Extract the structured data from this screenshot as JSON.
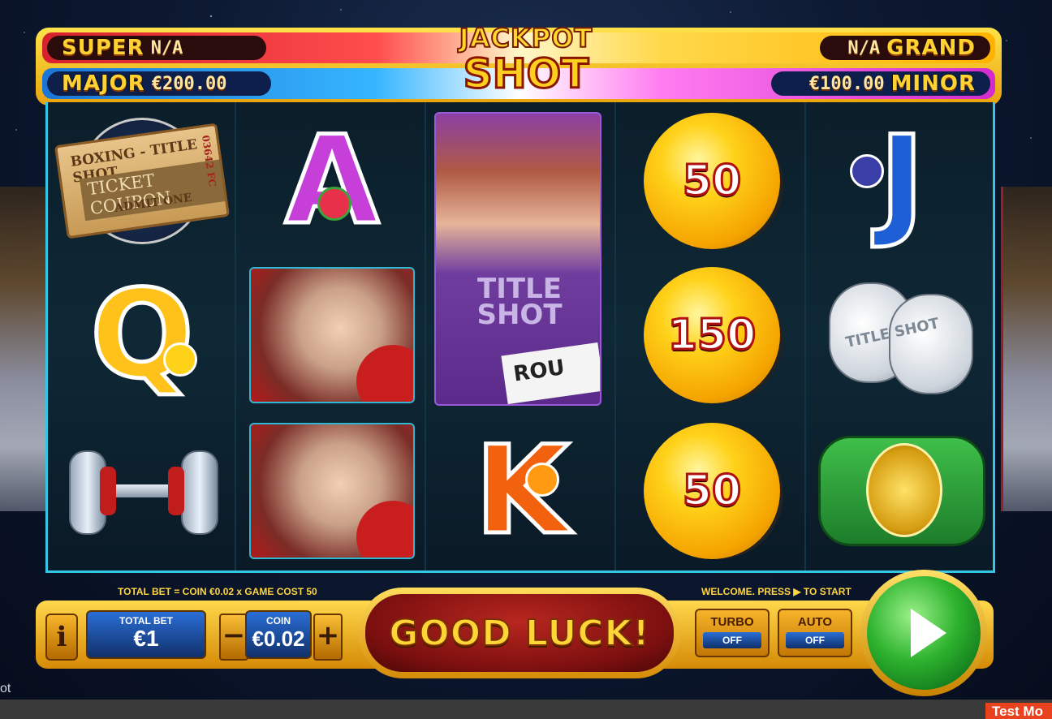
{
  "jackpots": {
    "super": {
      "label": "SUPER",
      "value": "N/A"
    },
    "grand": {
      "label": "GRAND",
      "value": "N/A"
    },
    "major": {
      "label": "MAJOR",
      "value": "€200.00"
    },
    "minor": {
      "label": "MINOR",
      "value": "€100.00"
    }
  },
  "logo": {
    "line1": "JACKPOT",
    "line2": "SHOT"
  },
  "reels": {
    "reel1": {
      "ticket": {
        "line1": "BOXING - TITLE SHOT",
        "line2": "TICKET COUPON",
        "line3": "ADMIT ONE",
        "serial": "03642 FC"
      },
      "q_letter": "Q"
    },
    "reel2": {
      "a_letter": "A"
    },
    "reel3": {
      "shirt_text": "TITLE SHOT",
      "card_text": "ROU",
      "k_letter": "K"
    },
    "reel4": {
      "coins": [
        "50",
        "150",
        "50"
      ]
    },
    "reel5": {
      "j_letter": "J",
      "glove_text": "TITLE SHOT"
    }
  },
  "colors": {
    "accent_gold": "#ffd642",
    "frame_cyan": "#34c6e6",
    "spin_green": "#2eb32e"
  },
  "controls": {
    "total_bet_caption": "TOTAL BET = COIN €0.02 x GAME COST 50",
    "welcome_caption": "WELCOME. PRESS ▶ TO START",
    "info_label": "i",
    "total_bet": {
      "label": "TOTAL BET",
      "value": "€1"
    },
    "coin": {
      "label": "COIN",
      "value": "€0.02",
      "minus": "−",
      "plus": "+"
    },
    "status": "GOOD LUCK!",
    "turbo": {
      "label": "TURBO",
      "state": "OFF"
    },
    "auto": {
      "label": "AUTO",
      "state": "OFF"
    },
    "spin_icon": "play-icon"
  },
  "footer": {
    "left_text": "ot",
    "test_mode": "Test Mo"
  }
}
